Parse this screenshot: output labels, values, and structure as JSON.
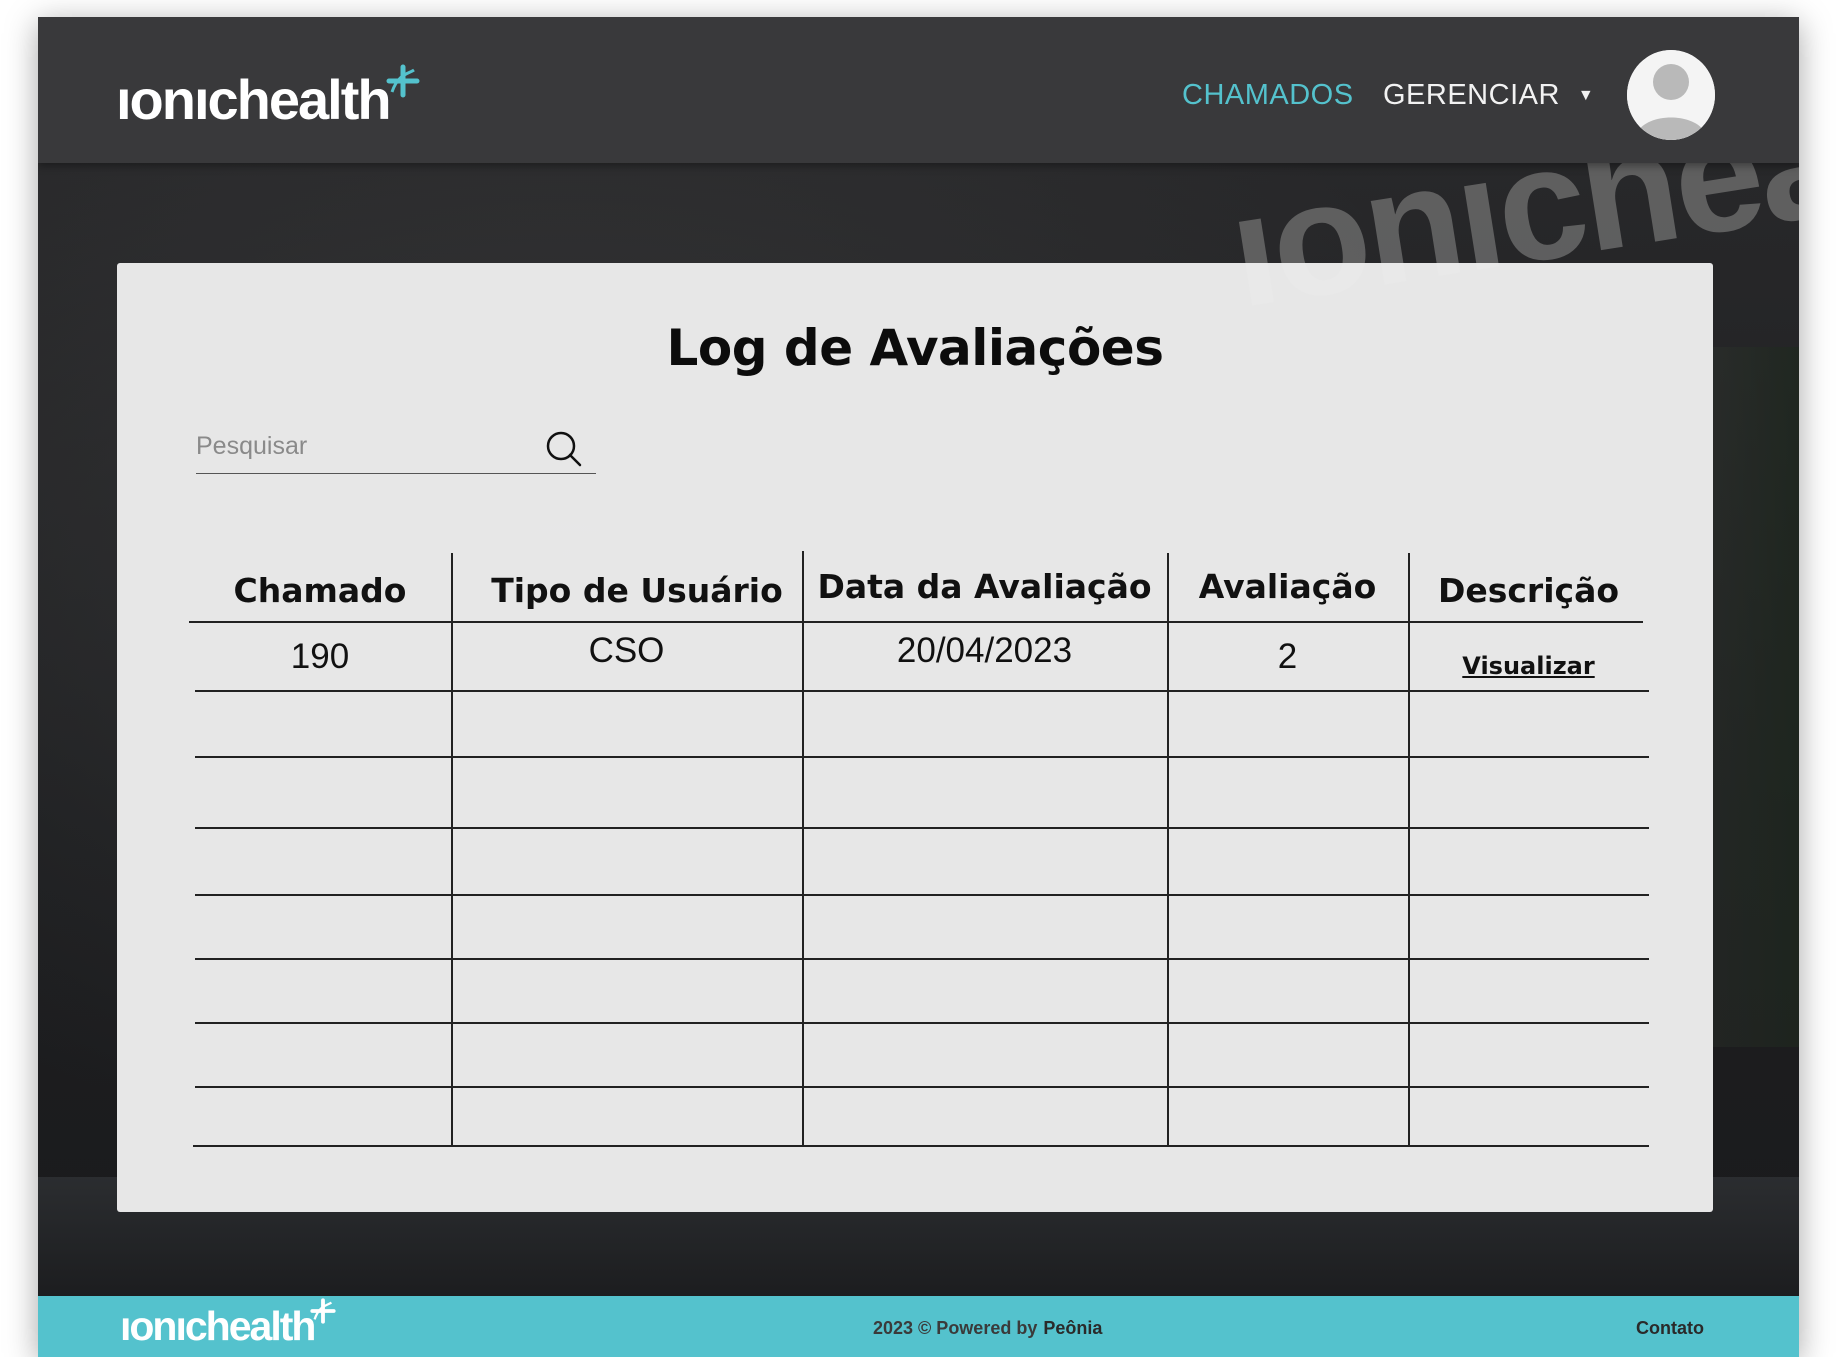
{
  "header": {
    "logo_text": "ıonıchealth",
    "nav": {
      "chamados": "CHAMADOS",
      "gerenciar": "GERENCIAR"
    },
    "colors": {
      "background": "#39393b",
      "active_nav": "#54c2cd",
      "nav": "#f2f2f2"
    }
  },
  "background": {
    "sign_text": "ıonıchealt"
  },
  "page": {
    "title": "Log de Avaliações",
    "search": {
      "placeholder": "Pesquisar",
      "value": ""
    }
  },
  "table": {
    "columns": [
      "Chamado",
      "Tipo de Usuário",
      "Data da Avaliação",
      "Avaliação",
      "Descrição"
    ],
    "rows": [
      {
        "chamado": "190",
        "tipo": "CSO",
        "data": "20/04/2023",
        "avaliacao": "2",
        "descricao": "Visualizar"
      }
    ],
    "empty_rows": 7
  },
  "footer": {
    "logo_text": "ıonıchealth",
    "copyright": "2023 © Powered by",
    "powered_brand": "Peônia",
    "contact": "Contato",
    "color": "#54c2cd"
  }
}
